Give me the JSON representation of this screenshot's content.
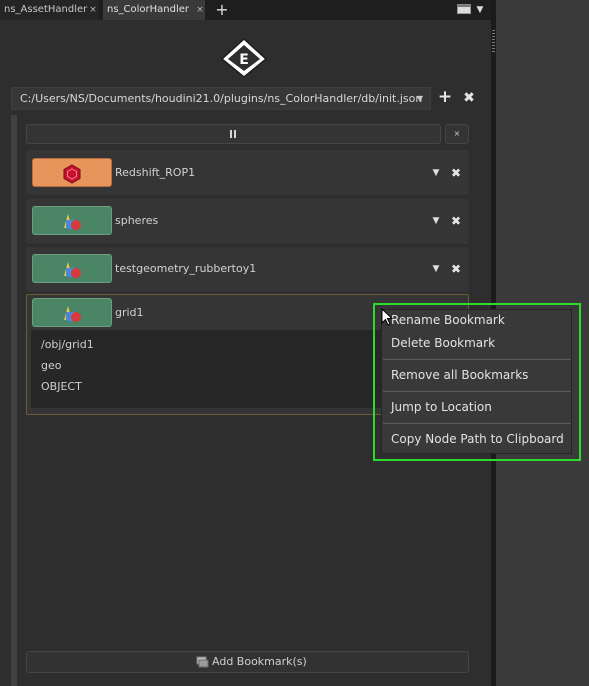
{
  "tabs": [
    {
      "label": "ns_AssetHandler",
      "close": "×"
    },
    {
      "label": "ns_ColorHandler",
      "close": "×"
    }
  ],
  "tab_add": "+",
  "tab_dropdown": "▼",
  "path": {
    "value": "C:/Users/NS/Documents/houdini21.0/plugins/ns_ColorHandler/db/init.json",
    "arrow": "▼",
    "add": "+",
    "close": "✖"
  },
  "pause_close": "×",
  "bookmarks": [
    {
      "name": "Redshift_ROP1",
      "color": "#e7955a",
      "icon": "redshift-rop-icon"
    },
    {
      "name": "spheres",
      "color": "#4a8566",
      "icon": "geometry-node-icon"
    },
    {
      "name": "testgeometry_rubbertoy1",
      "color": "#4a8566",
      "icon": "geometry-node-icon"
    },
    {
      "name": "grid1",
      "color": "#4a8566",
      "icon": "geometry-node-icon",
      "details": [
        "/obj/grid1",
        "geo",
        "OBJECT"
      ]
    }
  ],
  "row_controls": {
    "dropdown": "▼",
    "remove": "✖"
  },
  "add_bookmark": "Add Bookmark(s)",
  "context_menu": {
    "items": [
      "Rename Bookmark",
      "Delete Bookmark",
      "Remove all Bookmarks",
      "Jump to Location",
      "Copy Node Path to Clipboard"
    ]
  },
  "colors": {
    "highlight": "#2cdb2c",
    "selected_border": "#6c5a38"
  }
}
